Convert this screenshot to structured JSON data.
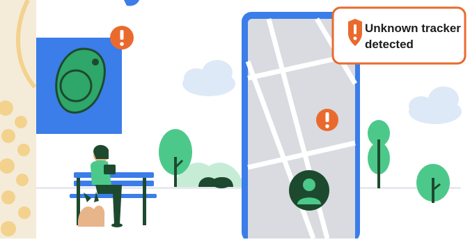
{
  "notification": {
    "line1": "Unknown tracker",
    "line2": "detected",
    "alert_color": "#ea6a2e"
  },
  "colors": {
    "brand_blue": "#3b7de9",
    "tracker_green": "#2fa66a",
    "tree_green": "#4cc98a",
    "map_gray": "#d9dbe0",
    "sky_cloud": "#dde9f7"
  },
  "icons": [
    "tracker-tag-icon",
    "alert-badge-icon",
    "shield-alert-icon",
    "person-pin-icon",
    "bench-icon",
    "tree-icon",
    "cloud-icon"
  ]
}
